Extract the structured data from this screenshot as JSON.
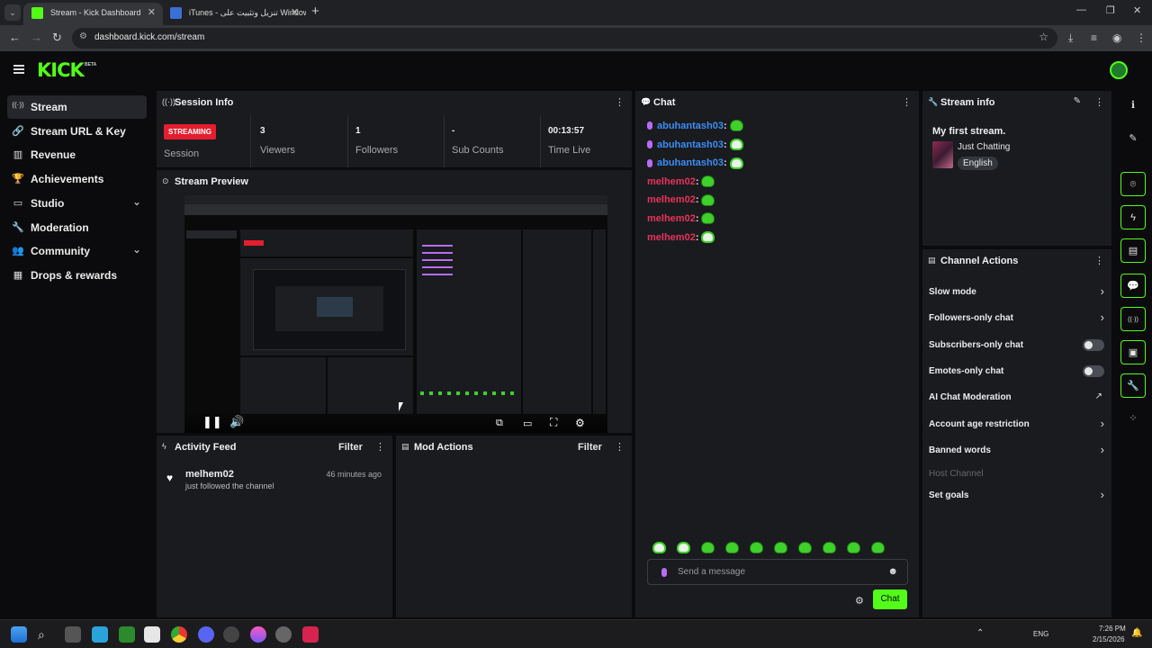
{
  "browser": {
    "tabs": [
      {
        "title": "Stream - Kick Dashboard",
        "active": true
      },
      {
        "title": "iTunes - تنزيل وتثبيت على Windows",
        "active": false
      }
    ],
    "url": "dashboard.kick.com/stream"
  },
  "header": {
    "logo": "KICK",
    "badge": "BETA"
  },
  "sidebar": {
    "items": [
      {
        "label": "Stream",
        "icon": "broadcast-icon",
        "glyph": "((·))",
        "active": true,
        "expandable": false
      },
      {
        "label": "Stream URL & Key",
        "icon": "link-icon",
        "glyph": "🔗",
        "active": false,
        "expandable": false
      },
      {
        "label": "Revenue",
        "icon": "bar-chart-icon",
        "glyph": "▥",
        "active": false,
        "expandable": false
      },
      {
        "label": "Achievements",
        "icon": "trophy-icon",
        "glyph": "🏆",
        "active": false,
        "expandable": false
      },
      {
        "label": "Studio",
        "icon": "monitor-icon",
        "glyph": "▭",
        "active": false,
        "expandable": true
      },
      {
        "label": "Moderation",
        "icon": "wrench-icon",
        "glyph": "🔧",
        "active": false,
        "expandable": false
      },
      {
        "label": "Community",
        "icon": "users-icon",
        "glyph": "👥",
        "active": false,
        "expandable": true
      },
      {
        "label": "Drops & rewards",
        "icon": "gift-icon",
        "glyph": "▦",
        "active": false,
        "expandable": false
      }
    ]
  },
  "session_info": {
    "title": "Session Info",
    "badge": "STREAMING",
    "session_label": "Session",
    "stats": [
      {
        "value": "3",
        "label": "Viewers"
      },
      {
        "value": "1",
        "label": "Followers"
      },
      {
        "value": "-",
        "label": "Sub Counts"
      },
      {
        "value": "00:13:57",
        "label": "Time Live"
      }
    ]
  },
  "stream_preview": {
    "title": "Stream Preview"
  },
  "activity_feed": {
    "title": "Activity Feed",
    "filter": "Filter",
    "items": [
      {
        "user": "melhem02",
        "time": "46 minutes ago",
        "message": "just followed the channel"
      }
    ]
  },
  "mod_actions": {
    "title": "Mod Actions",
    "filter": "Filter"
  },
  "chat": {
    "title": "Chat",
    "messages": [
      {
        "user": "abuhantash03",
        "color": "#3b8df5",
        "mic": true,
        "emote": "green"
      },
      {
        "user": "abuhantash03",
        "color": "#3b8df5",
        "mic": true,
        "emote": "white"
      },
      {
        "user": "abuhantash03",
        "color": "#3b8df5",
        "mic": true,
        "emote": "white"
      },
      {
        "user": "melhem02",
        "color": "#e8335a",
        "mic": false,
        "emote": "green"
      },
      {
        "user": "melhem02",
        "color": "#e8335a",
        "mic": false,
        "emote": "green"
      },
      {
        "user": "melhem02",
        "color": "#e8335a",
        "mic": false,
        "emote": "green"
      },
      {
        "user": "melhem02",
        "color": "#e8335a",
        "mic": false,
        "emote": "white"
      }
    ],
    "emote_bar": [
      "white",
      "white",
      "green",
      "green",
      "green",
      "green",
      "green",
      "green",
      "green",
      "green"
    ],
    "input_placeholder": "Send a message",
    "send_label": "Chat"
  },
  "stream_info": {
    "title": "Stream info",
    "stream_title": "My first stream.",
    "category": "Just Chatting",
    "language": "English"
  },
  "channel_actions": {
    "title": "Channel Actions",
    "items": [
      {
        "label": "Slow mode",
        "control": "chevron"
      },
      {
        "label": "Followers-only chat",
        "control": "chevron"
      },
      {
        "label": "Subscribers-only chat",
        "control": "toggle"
      },
      {
        "label": "Emotes-only chat",
        "control": "toggle"
      },
      {
        "label": "AI Chat Moderation",
        "control": "external"
      },
      {
        "label": "Account age restriction",
        "control": "chevron"
      },
      {
        "label": "Banned words",
        "control": "chevron"
      },
      {
        "label": "Host Channel",
        "control": "none"
      },
      {
        "label": "Set goals",
        "control": "chevron"
      }
    ]
  },
  "right_rail": [
    {
      "icon": "info-icon",
      "glyph": "ℹ",
      "outlined": false
    },
    {
      "icon": "edit-icon",
      "glyph": "✎",
      "outlined": false
    },
    {
      "icon": "focus-icon",
      "glyph": "⌾",
      "outlined": true
    },
    {
      "icon": "lightning-icon",
      "glyph": "ϟ",
      "outlined": true
    },
    {
      "icon": "document-icon",
      "glyph": "▤",
      "outlined": true
    },
    {
      "icon": "chat-bubble-icon",
      "glyph": "💬",
      "outlined": true
    },
    {
      "icon": "broadcast-icon",
      "glyph": "((·))",
      "outlined": true
    },
    {
      "icon": "layout-icon",
      "glyph": "▣",
      "outlined": true
    },
    {
      "icon": "wrench-icon",
      "glyph": "🔧",
      "outlined": true
    },
    {
      "icon": "add-widget-icon",
      "glyph": "⁘",
      "outlined": false
    }
  ],
  "taskbar": {
    "lang": "ENG",
    "time": "7:26 PM",
    "date": "2/15/2026"
  },
  "colors": {
    "accent": "#53fc18",
    "live_red": "#e41e2e",
    "bg": "#0b0b0d",
    "panel": "#191b1f"
  }
}
